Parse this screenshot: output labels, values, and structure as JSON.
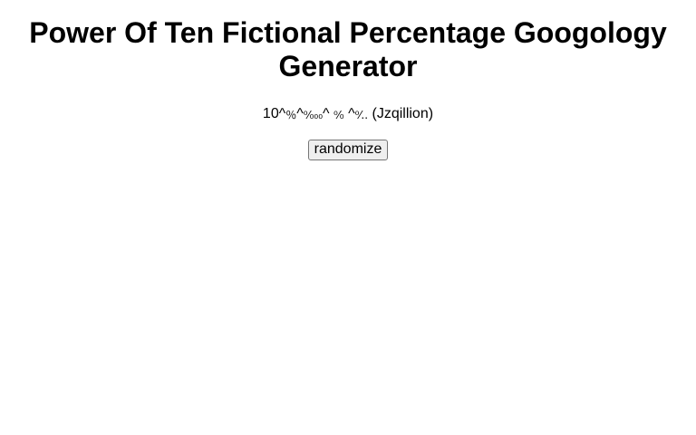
{
  "page": {
    "title": "Power Of Ten Fictional Percentage Googology Generator"
  },
  "expression": {
    "prefix": "10^",
    "term1": "％",
    "sep1": "^",
    "term2": "⁰⁄₀₀₀",
    "sep2": "^",
    "term3": "⁰⁄₀",
    "sep3": "^",
    "term4": "⁰⁄..",
    "name": "(Jzqillion)"
  },
  "controls": {
    "randomize_label": "randomize"
  }
}
